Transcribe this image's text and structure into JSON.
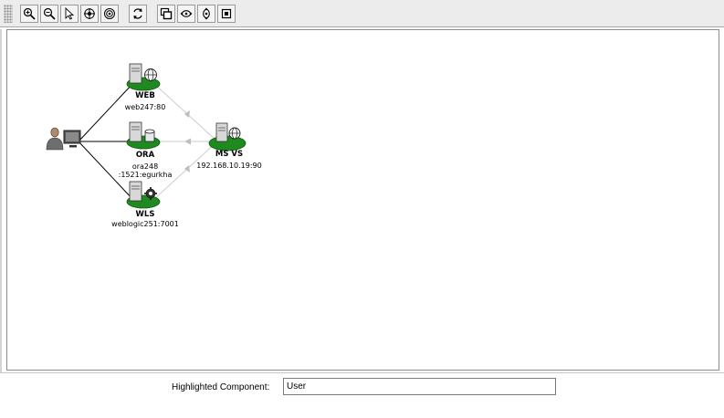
{
  "toolbar": {
    "buttons": [
      {
        "icon": "zoom-in-icon"
      },
      {
        "icon": "zoom-out-icon"
      },
      {
        "icon": "select-arrow-icon"
      },
      {
        "icon": "pan-icon"
      },
      {
        "icon": "fit-to-window-icon"
      },
      {
        "icon": "refresh-icon"
      },
      {
        "icon": "overview-window-icon"
      },
      {
        "icon": "horizontal-layout-icon"
      },
      {
        "icon": "vertical-layout-icon"
      },
      {
        "icon": "center-icon"
      }
    ]
  },
  "diagram": {
    "nodes": {
      "user": {
        "icon": "user-workstation-icon"
      },
      "web": {
        "name": "WEB",
        "detail": "web247:80",
        "icon": "web-server-icon"
      },
      "ora": {
        "name": "ORA",
        "detail_line1": "ora248",
        "detail_line2": ":1521:egurkha",
        "icon": "database-server-icon"
      },
      "wls": {
        "name": "WLS",
        "detail": "weblogic251:7001",
        "icon": "weblogic-server-icon"
      },
      "msvs": {
        "name": "MS VS",
        "detail": "192.168.10.19:90",
        "icon": "virtual-server-icon"
      }
    },
    "colors": {
      "node_ellipse": "#1f8a1f",
      "user_edge": "#000000",
      "dependency_edge": "#c8c8c8",
      "arrowhead": "#c0c0c0"
    }
  },
  "status": {
    "label": "Highlighted Component:",
    "value": "User"
  }
}
